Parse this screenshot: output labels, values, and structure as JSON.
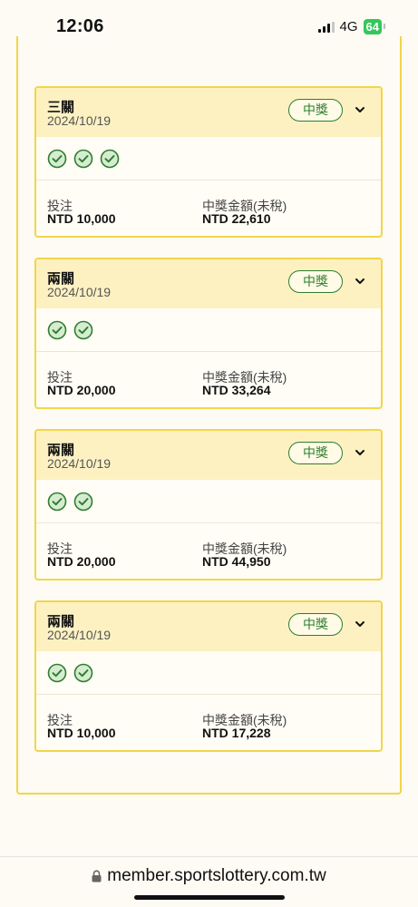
{
  "status_bar": {
    "time": "12:06",
    "network": "4G",
    "battery": "64"
  },
  "bets": [
    {
      "title": "三關",
      "date": "2024/10/19",
      "badge": "中獎",
      "checks": 3,
      "bet_label": "投注",
      "bet_value": "NTD 10,000",
      "prize_label": "中獎金額(未稅)",
      "prize_value": "NTD 22,610"
    },
    {
      "title": "兩關",
      "date": "2024/10/19",
      "badge": "中獎",
      "checks": 2,
      "bet_label": "投注",
      "bet_value": "NTD 20,000",
      "prize_label": "中獎金額(未稅)",
      "prize_value": "NTD 33,264"
    },
    {
      "title": "兩關",
      "date": "2024/10/19",
      "badge": "中獎",
      "checks": 2,
      "bet_label": "投注",
      "bet_value": "NTD 20,000",
      "prize_label": "中獎金額(未稅)",
      "prize_value": "NTD 44,950"
    },
    {
      "title": "兩關",
      "date": "2024/10/19",
      "badge": "中獎",
      "checks": 2,
      "bet_label": "投注",
      "bet_value": "NTD 10,000",
      "prize_label": "中獎金額(未稅)",
      "prize_value": "NTD 17,228"
    }
  ],
  "browser": {
    "url": "member.sportslottery.com.tw"
  },
  "colors": {
    "accent_border": "#f2d54a",
    "header_bg": "#fdf1c2",
    "win_green": "#2e7d32"
  }
}
